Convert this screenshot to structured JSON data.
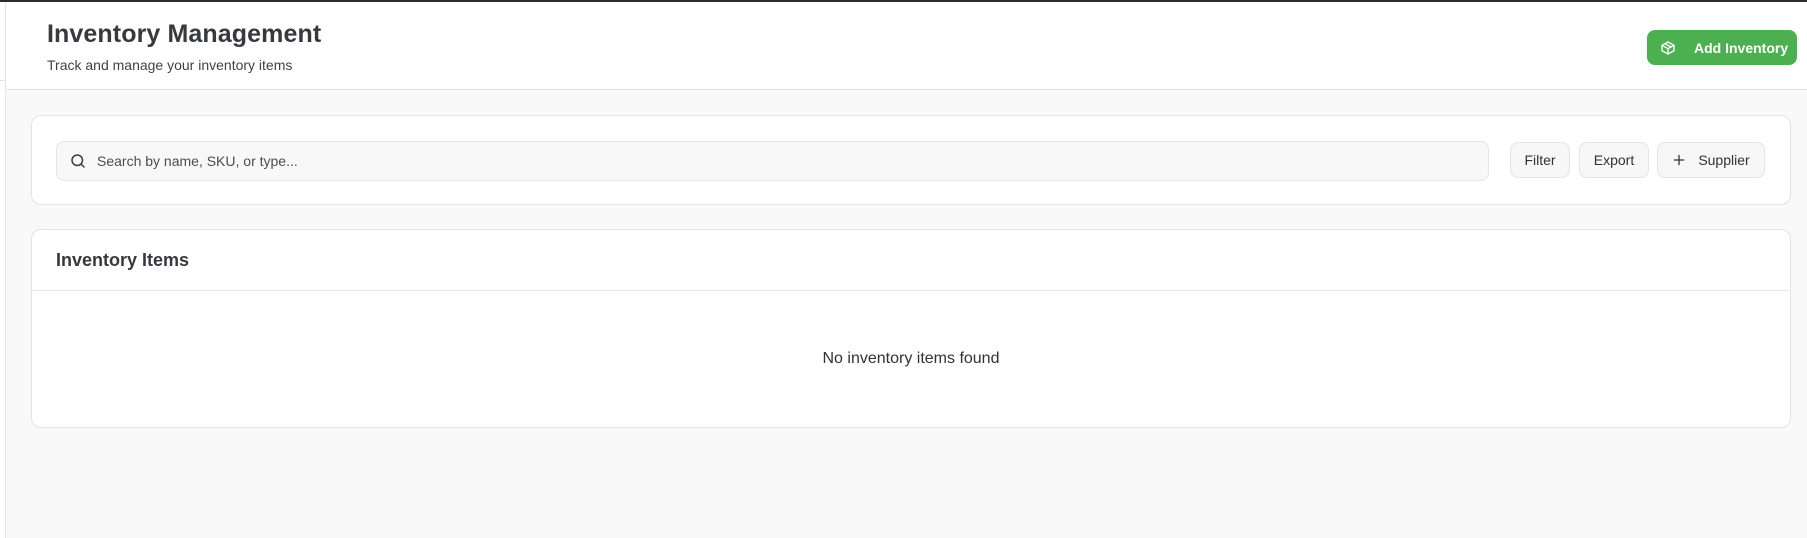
{
  "header": {
    "title": "Inventory Management",
    "subtitle": "Track and manage your inventory items",
    "add_button": {
      "label": "Add Inventory",
      "icon": "package-icon"
    }
  },
  "toolbar": {
    "search": {
      "placeholder": "Search by name, SKU, or type...",
      "value": "",
      "icon": "search-icon"
    },
    "filter_label": "Filter",
    "export_label": "Export",
    "supplier_label": "Supplier",
    "supplier_icon": "plus-icon"
  },
  "items_panel": {
    "title": "Inventory Items",
    "empty_message": "No inventory items found"
  },
  "colors": {
    "accent": "#4caf50",
    "background": "#f9f9f9",
    "card": "#ffffff",
    "text": "#333639"
  }
}
